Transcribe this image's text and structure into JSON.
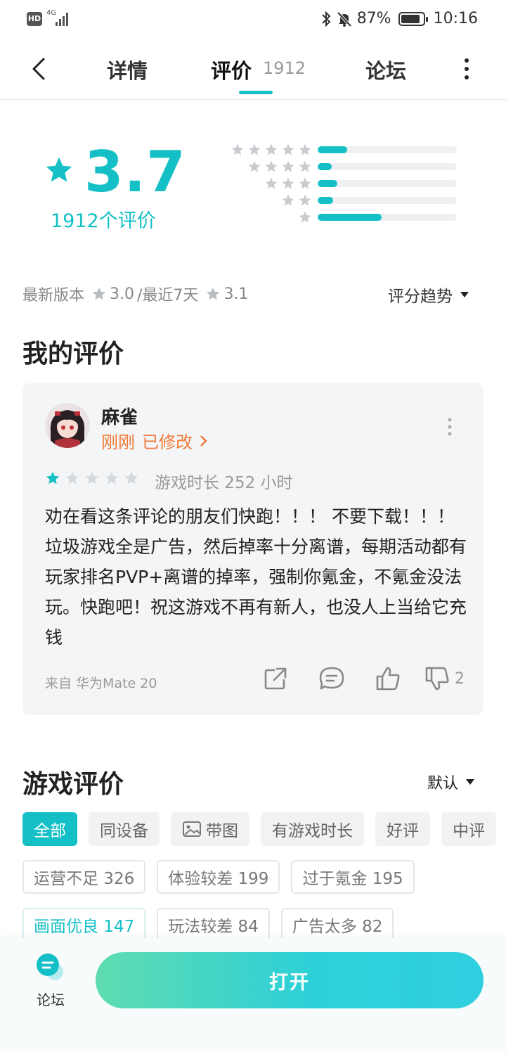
{
  "status_bar": {
    "hd_label": "HD",
    "network": "4G",
    "battery": "87%",
    "time": "10:16"
  },
  "nav": {
    "tabs": [
      {
        "label": "详情"
      },
      {
        "label": "评价",
        "count": "1912"
      },
      {
        "label": "论坛"
      }
    ],
    "active_tab": 1
  },
  "rating": {
    "score": "3.7",
    "count_label": "1912个评价",
    "distribution": [
      {
        "stars": 5,
        "fraction": 0.21
      },
      {
        "stars": 4,
        "fraction": 0.1
      },
      {
        "stars": 3,
        "fraction": 0.14
      },
      {
        "stars": 2,
        "fraction": 0.11
      },
      {
        "stars": 1,
        "fraction": 0.46
      }
    ],
    "latest_version_label": "最新版本",
    "latest_version_score": "3.0",
    "recent_label": "/最近7天",
    "recent_score": "3.1",
    "trend_label": "评分趋势"
  },
  "my_review": {
    "heading": "我的评价",
    "user": "麻雀",
    "time": "刚刚",
    "edited": "已修改",
    "stars": 1,
    "playtime": "游戏时长 252 小时",
    "text": "劝在看这条评论的朋友们快跑！！！ 不要下载！！！ 垃圾游戏全是广告，然后掉率十分离谱，每期活动都有玩家排名PVP+离谱的掉率，强制你氪金，不氪金没法玩。快跑吧！祝这游戏不再有新人，也没人上当给它充钱",
    "device": "来自 华为Mate 20",
    "dislike_count": "2"
  },
  "game_reviews": {
    "heading": "游戏评价",
    "sort_label": "默认",
    "filters": [
      "全部",
      "同设备",
      "带图",
      "有游戏时长",
      "好评",
      "中评"
    ],
    "active_filter": 0,
    "tags_row1": [
      "运营不足 326",
      "体验较差 199",
      "过于氪金 195"
    ],
    "tags_row2": [
      "画面优良 147",
      "玩法较差 84",
      "广告太多 82"
    ]
  },
  "bottom": {
    "forum_label": "论坛",
    "open_label": "打开"
  },
  "colors": {
    "accent": "#14bfc6",
    "orange": "#f07a3a",
    "star_gray": "#c8cbcf"
  }
}
